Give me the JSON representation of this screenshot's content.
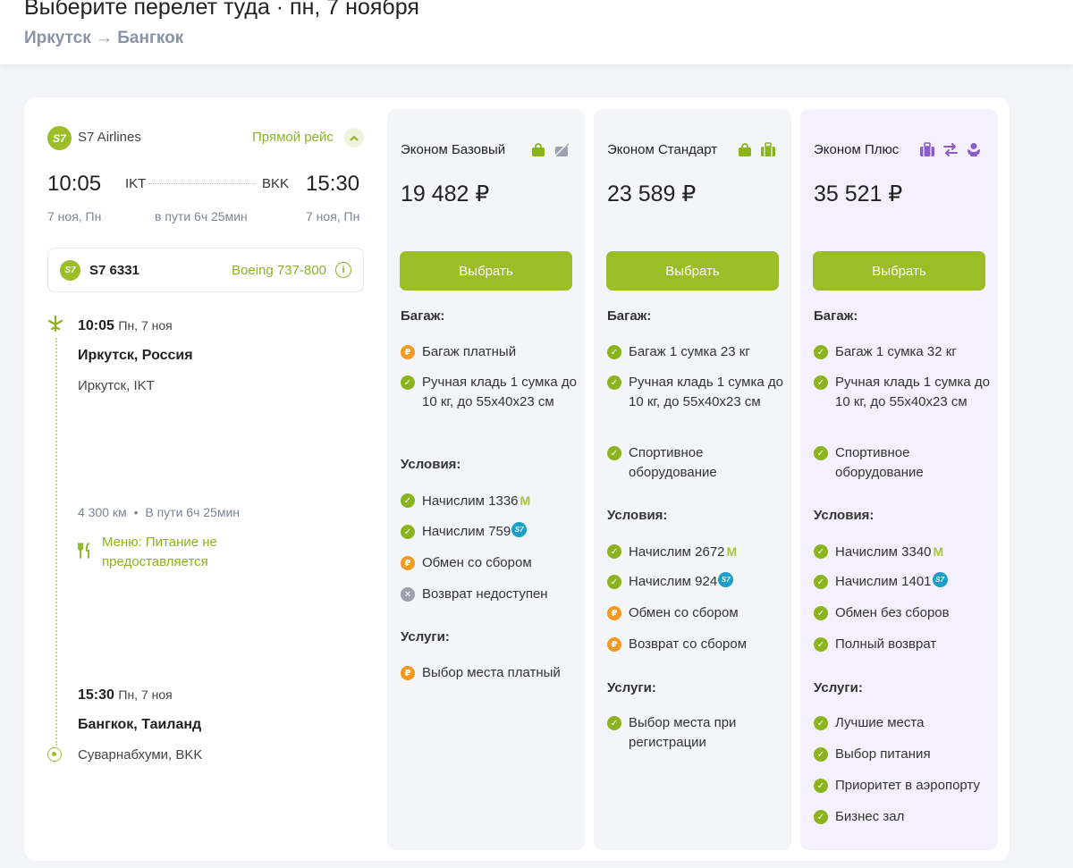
{
  "header": {
    "title": "Выберите перелет туда · пн, 7 ноября",
    "route": "Иркутск → Бангкок"
  },
  "flight": {
    "airline_logo": "S7",
    "airline": "S7 Airlines",
    "direct_label": "Прямой рейс",
    "dep_time": "10:05",
    "dep_code": "IKT",
    "arr_code": "BKK",
    "arr_time": "15:30",
    "dep_date": "7 ноя, Пн",
    "duration": "в пути 6ч 25мин",
    "arr_date": "7 ноя, Пн",
    "flight_number": "S7 6331",
    "aircraft": "Boeing 737-800",
    "info_glyph": "i",
    "segment": {
      "dep_time": "10:05",
      "dep_day": "Пн, 7 ноя",
      "dep_city": "Иркутск, Россия",
      "dep_airport": "Иркутск, IKT",
      "distance": "4 300 км",
      "separator": "•",
      "duration": "В пути 6ч 25мин",
      "meal": "Меню: Питание не предоставляется",
      "arr_time": "15:30",
      "arr_day": "Пн, 7 ноя",
      "arr_city": "Бангкок, Таиланд",
      "arr_airport": "Суварнабхуми, BKK"
    }
  },
  "colors": {
    "accent": "#9bbd28",
    "paid": "#f39a1e",
    "unavailable": "#9aa1ad",
    "plus_icons": "#8b5cc9",
    "plus_bg": "#f5f0fd"
  },
  "glyphs": {
    "ok": "✓",
    "pay": "₽",
    "no": "✕",
    "miles": "M",
    "s7": "S7"
  },
  "fares": [
    {
      "name": "Эконом Базовый",
      "icons": [
        "hand-bag-icon",
        "no-baggage-icon"
      ],
      "price": "19 482 ₽",
      "button": "Выбрать",
      "baggage_title": "Багаж:",
      "baggage": [
        {
          "status": "pay",
          "text": "Багаж платный"
        },
        {
          "status": "ok",
          "text": "Ручная кладь 1 сумка до 10 кг, до 55х40х23 см"
        }
      ],
      "conditions_title": "Условия:",
      "conditions": [
        {
          "status": "ok",
          "text": "Начислим 1336"
        },
        {
          "status": "ok",
          "text": "Начислим  759"
        },
        {
          "status": "pay",
          "text": "Обмен со сбором"
        },
        {
          "status": "no",
          "text": "Возврат недоступен"
        }
      ],
      "services_title": "Услуги:",
      "services": [
        {
          "status": "pay",
          "text": "Выбор места платный"
        }
      ]
    },
    {
      "name": "Эконом Стандарт",
      "icons": [
        "hand-bag-icon",
        "suitcase-icon"
      ],
      "price": "23 589 ₽",
      "button": "Выбрать",
      "baggage_title": "Багаж:",
      "baggage": [
        {
          "status": "ok",
          "text": "Багаж 1 сумка 23 кг"
        },
        {
          "status": "ok",
          "text": "Ручная кладь 1 сумка до 10 кг, до 55х40х23 см"
        },
        {
          "status": "ok",
          "text": "Спортивное оборудование"
        }
      ],
      "conditions_title": "Условия:",
      "conditions": [
        {
          "status": "ok",
          "text": "Начислим 2672"
        },
        {
          "status": "ok",
          "text": "Начислим  924"
        },
        {
          "status": "pay",
          "text": "Обмен со сбором"
        },
        {
          "status": "pay",
          "text": "Возврат со сбором"
        }
      ],
      "services_title": "Услуги:",
      "services": [
        {
          "status": "ok",
          "text": "Выбор места при регистрации"
        }
      ]
    },
    {
      "name": "Эконом Плюс",
      "icons": [
        "suitcase-icon",
        "exchange-icon",
        "seat-icon"
      ],
      "price": "35 521 ₽",
      "button": "Выбрать",
      "baggage_title": "Багаж:",
      "baggage": [
        {
          "status": "ok",
          "text": "Багаж 1 сумка 32 кг"
        },
        {
          "status": "ok",
          "text": "Ручная кладь 1 сумка до 10 кг, до 55х40х23 см"
        },
        {
          "status": "ok",
          "text": "Спортивное оборудование"
        }
      ],
      "conditions_title": "Условия:",
      "conditions": [
        {
          "status": "ok",
          "text": "Начислим 3340"
        },
        {
          "status": "ok",
          "text": "Начислим  1401"
        },
        {
          "status": "ok",
          "text": "Обмен без сборов"
        },
        {
          "status": "ok",
          "text": "Полный возврат"
        }
      ],
      "services_title": "Услуги:",
      "services": [
        {
          "status": "ok",
          "text": "Лучшие места"
        },
        {
          "status": "ok",
          "text": "Выбор питания"
        },
        {
          "status": "ok",
          "text": "Приоритет в аэропорту"
        },
        {
          "status": "ok",
          "text": "Бизнес зал"
        }
      ]
    }
  ]
}
